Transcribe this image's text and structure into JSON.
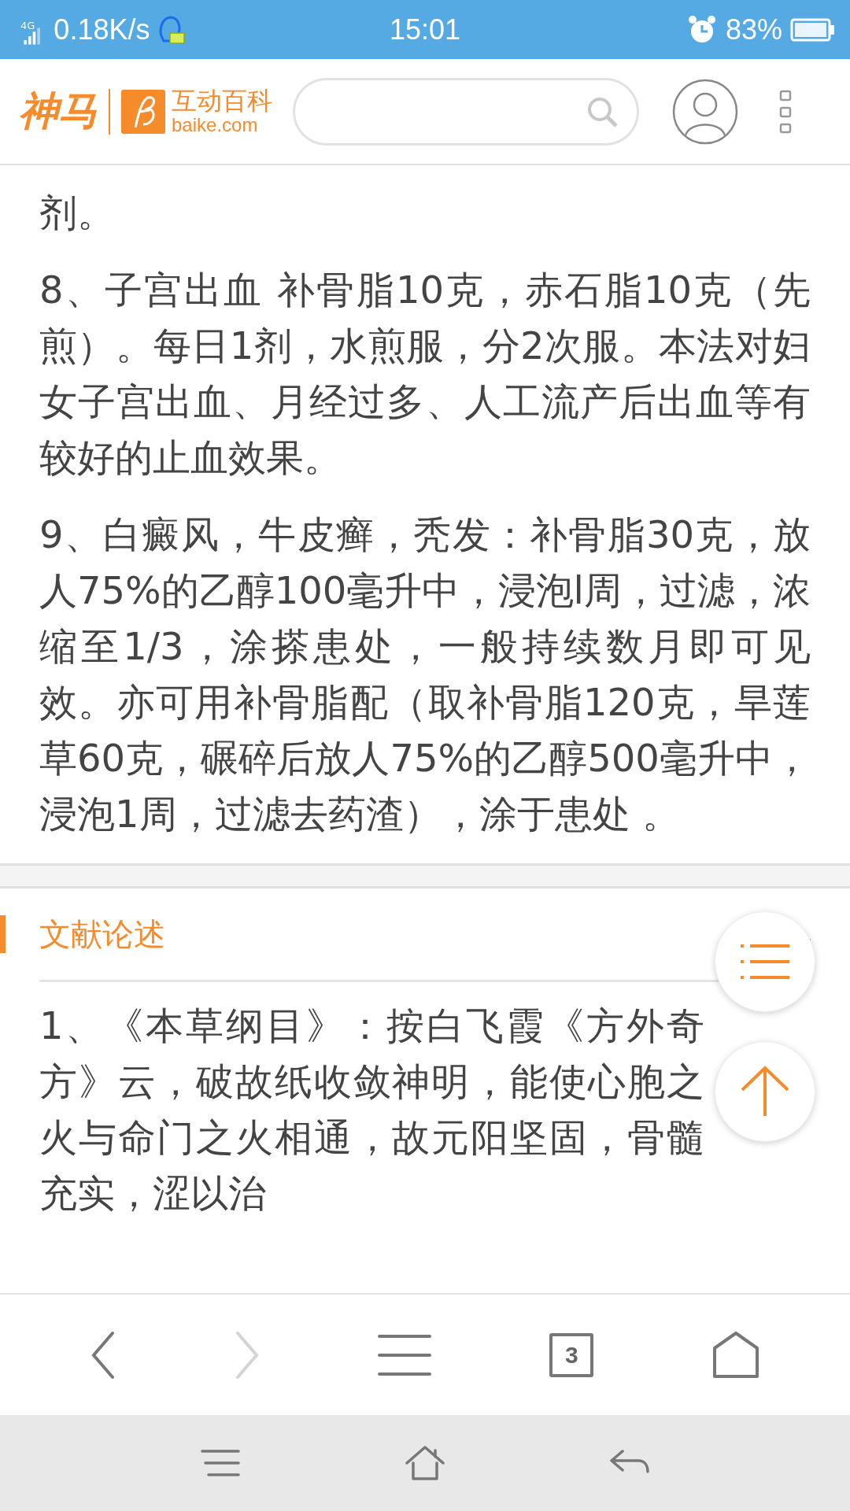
{
  "status_bar": {
    "network": "4G",
    "speed": "0.18K/s",
    "time": "15:01",
    "battery": "83%"
  },
  "header": {
    "logo_text": "神马",
    "brand_name": "互动百科",
    "brand_domain": "baike.com"
  },
  "article": {
    "paragraphs": [
      "剂。",
      "8、子宫出血 补骨脂10克，赤石脂10克（先煎）。每日1剂，水煎服，分2次服。本法对妇女子宫出血、月经过多、人工流产后出血等有较好的止血效果。",
      "9、白癜风，牛皮癣，秃发：补骨脂30克，放人75%的乙醇100毫升中，浸泡l周，过滤，浓缩至1/3，涂搽患处，一般持续数月即可见效。亦可用补骨脂配（取补骨脂120克，旱莲草60克，碾碎后放人75%的乙醇500毫升中，浸泡1周，过滤去药渣），涂于患处 。"
    ]
  },
  "section": {
    "title": "文献论述",
    "paragraphs": [
      "1、《本草纲目》：按白飞霞《方外奇方》云，破故纸收敛神明，能使心胞之火与命门之火相通，故元阳坚固，骨髓充实，涩以治"
    ]
  },
  "toolbar": {
    "back": {
      "disabled": false
    },
    "forward": {
      "disabled": true
    },
    "tab_count": "3"
  }
}
